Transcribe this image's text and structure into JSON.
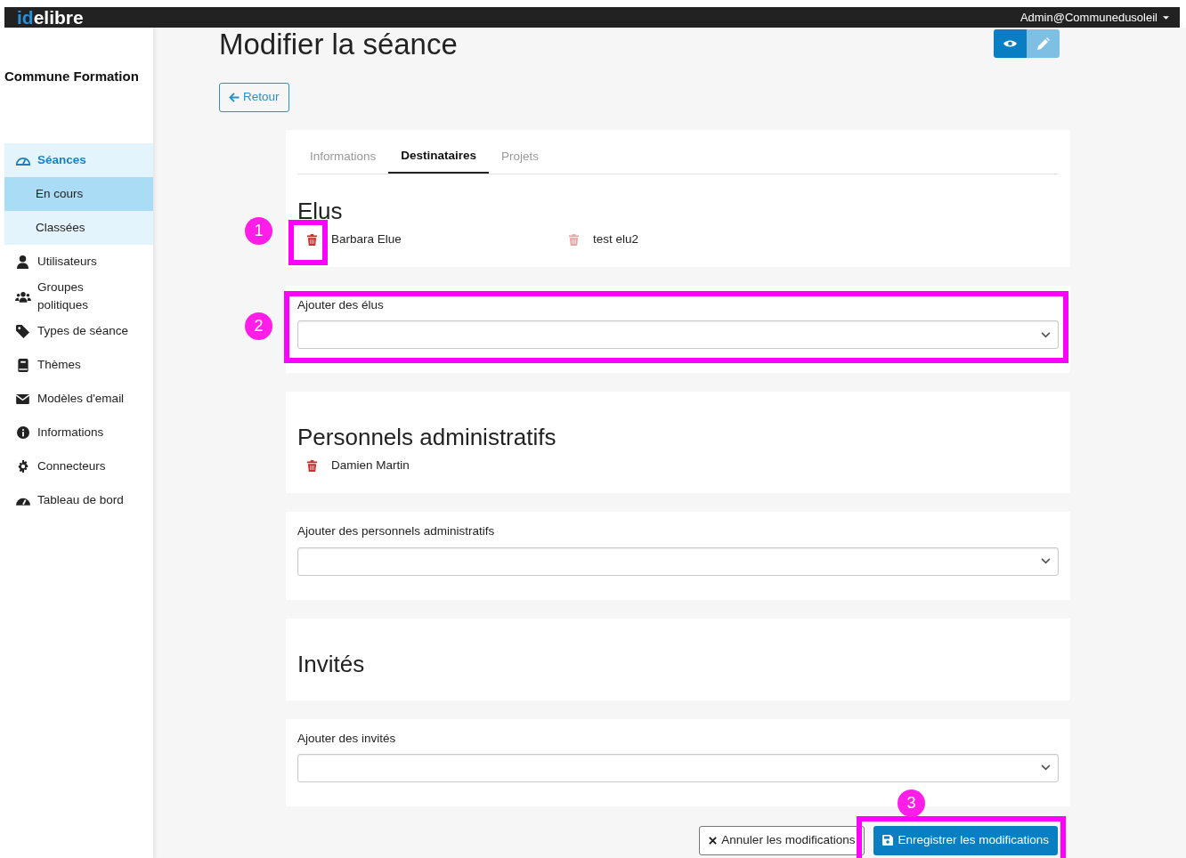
{
  "topbar": {
    "logo_prefix": "id",
    "logo_suffix": "elibre",
    "user": "Admin@Communedusoleil"
  },
  "sidebar": {
    "title": "Commune Formation",
    "items": [
      {
        "label": "Séances",
        "selected": false,
        "expanded": true,
        "children": [
          {
            "label": "En cours",
            "selected": true
          },
          {
            "label": "Classées",
            "selected": false
          }
        ]
      },
      {
        "label": "Utilisateurs",
        "selected": false
      },
      {
        "label": "Groupes politiques",
        "selected": false
      },
      {
        "label": "Types de séance",
        "selected": false
      },
      {
        "label": "Thèmes",
        "selected": false
      },
      {
        "label": "Modèles d'email",
        "selected": false
      },
      {
        "label": "Informations",
        "selected": false
      },
      {
        "label": "Connecteurs",
        "selected": false
      },
      {
        "label": "Tableau de bord",
        "selected": false
      }
    ]
  },
  "page": {
    "title": "Modifier la séance",
    "back_button": "Retour",
    "view_modes": [
      {
        "selected": true
      },
      {
        "selected": false
      }
    ]
  },
  "tabs": [
    {
      "label": "Informations",
      "selected": false
    },
    {
      "label": "Destinataires",
      "selected": true
    },
    {
      "label": "Projets",
      "selected": false
    }
  ],
  "sections": [
    {
      "title": "Elus",
      "members": [
        {
          "name": "Barbara Elue",
          "disabled": false
        },
        {
          "name": "test elu2",
          "disabled": true
        }
      ],
      "add_label": "Ajouter des élus"
    },
    {
      "title": "Personnels administratifs",
      "members": [
        {
          "name": "Damien Martin",
          "disabled": false
        }
      ],
      "add_label": "Ajouter des personnels administratifs"
    },
    {
      "title": "Invités",
      "add_label": "Ajouter des invités"
    }
  ],
  "actions": {
    "cancel": "Annuler les modifications",
    "save": "Enregistrer les modifications"
  },
  "annotations": [
    {
      "label": "1"
    },
    {
      "label": "2"
    },
    {
      "label": "3"
    }
  ]
}
